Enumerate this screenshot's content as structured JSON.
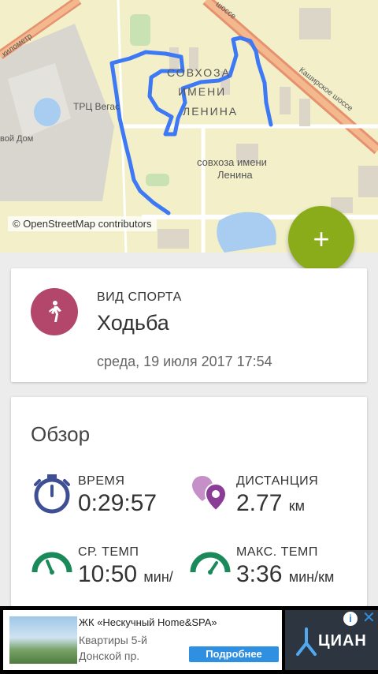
{
  "map": {
    "attribution": "© OpenStreetMap contributors",
    "labels": {
      "district_1": "СОВХОЗА",
      "district_2": "ИМЕНИ",
      "district_3": "ЛЕНИНА",
      "village_1": "совхоза имени",
      "village_2": "Ленина",
      "mall": "ТРЦ Вегас",
      "road_km": "километр",
      "home": "вой Дом",
      "kashirskoe": "Каширское шоссе",
      "shosse": "шоссе"
    },
    "route_color": "#3d78f5"
  },
  "fab": {
    "label": "+",
    "color": "#8aab1a"
  },
  "activity": {
    "sport_label": "ВИД СПОРТА",
    "sport_value": "Ходьба",
    "date": "среда, 19 июля 2017 17:54",
    "icon": "walking-person-icon",
    "icon_color": "#b3466b"
  },
  "overview": {
    "title": "Обзор",
    "time": {
      "label": "ВРЕМЯ",
      "value": "0:29:57",
      "icon": "stopwatch-icon"
    },
    "distance": {
      "label": "ДИСТАНЦИЯ",
      "value": "2.77",
      "unit": "км",
      "icon": "location-pins-icon"
    },
    "avg_pace": {
      "label": "СР. ТЕМП",
      "value": "10:50",
      "unit": "мин/",
      "icon": "speedometer-icon"
    },
    "max_pace": {
      "label": "МАКС. ТЕМП",
      "value": "3:36",
      "unit": "мин/км",
      "icon": "speedometer-icon"
    }
  },
  "ad": {
    "title": "ЖК «Нескучный Home&SPA»",
    "line1": "Квартиры 5-й",
    "line2": "Донской пр.",
    "button": "Подробнее",
    "brand": "ЦИАН",
    "info": "i",
    "close": "✕"
  }
}
